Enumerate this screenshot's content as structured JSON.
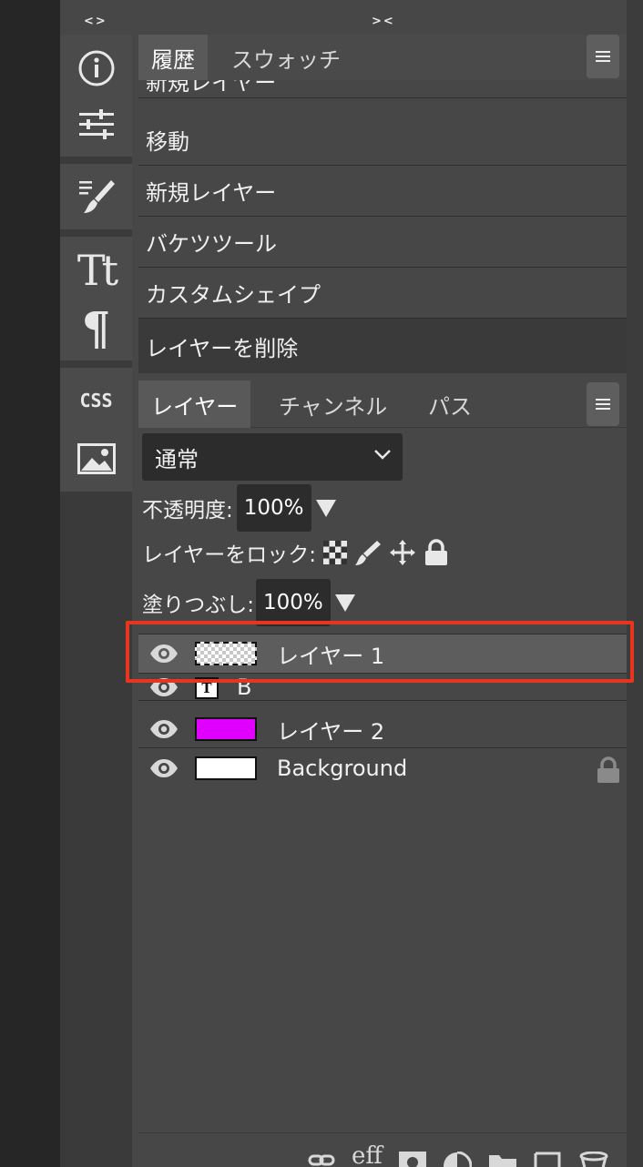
{
  "collapse_left": "<>",
  "collapse_right": "><",
  "toolbar": {
    "icons": [
      "info-icon",
      "adjustments-icon",
      "brush-settings-icon",
      "character-icon",
      "paragraph-icon",
      "css-icon",
      "image-icon"
    ],
    "character_glyph": "Tt",
    "paragraph_glyph": "¶",
    "css_label": "CSS"
  },
  "history": {
    "tabs": [
      "履歴",
      "スウォッチ"
    ],
    "active_tab": "履歴",
    "items": [
      "新規レイヤー",
      "移動",
      "新規レイヤー",
      "バケツツール",
      "カスタムシェイプ",
      "レイヤーを削除"
    ],
    "selected_index": 5
  },
  "layers_panel": {
    "tabs": [
      "レイヤー",
      "チャンネル",
      "パス"
    ],
    "active_tab": "レイヤー",
    "blend_mode": "通常",
    "opacity_label": "不透明度:",
    "opacity_value": "100%",
    "lock_label": "レイヤーをロック:",
    "fill_label": "塗りつぶし:",
    "fill_value": "100%",
    "layers": [
      {
        "name": "レイヤー 1",
        "thumb": "transparent",
        "selected": true
      },
      {
        "name": "B",
        "thumb": "text",
        "text_glyph": "T",
        "selected": false
      },
      {
        "name": "レイヤー 2",
        "thumb": "#e000ff",
        "selected": false
      },
      {
        "name": "Background",
        "thumb": "#ffffff",
        "selected": false,
        "locked": true
      }
    ],
    "bottom_icons": [
      "link-icon",
      "effects-icon",
      "mask-icon",
      "adjustment-layer-icon",
      "folder-icon",
      "new-layer-icon",
      "trash-icon"
    ],
    "effects_label": "eff"
  },
  "colors": {
    "highlight": "#e8361e",
    "panel": "#474747",
    "selected_row": "#5d5d5d"
  }
}
